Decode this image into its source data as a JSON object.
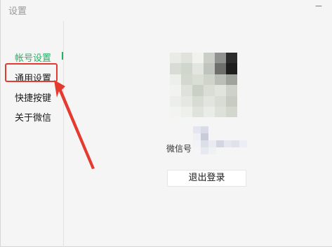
{
  "window": {
    "title": "设置",
    "minimize_glyph": "−"
  },
  "sidebar": {
    "items": [
      {
        "label": "帐号设置",
        "active": true
      },
      {
        "label": "通用设置",
        "active": false,
        "highlighted": true
      },
      {
        "label": "快捷按键",
        "active": false
      },
      {
        "label": "关于微信",
        "active": false
      }
    ]
  },
  "account": {
    "wechat_id_label": "微信号",
    "logout_label": "退出登录"
  },
  "colors": {
    "accent": "#2aae67",
    "annotation": "#e53a2f"
  }
}
